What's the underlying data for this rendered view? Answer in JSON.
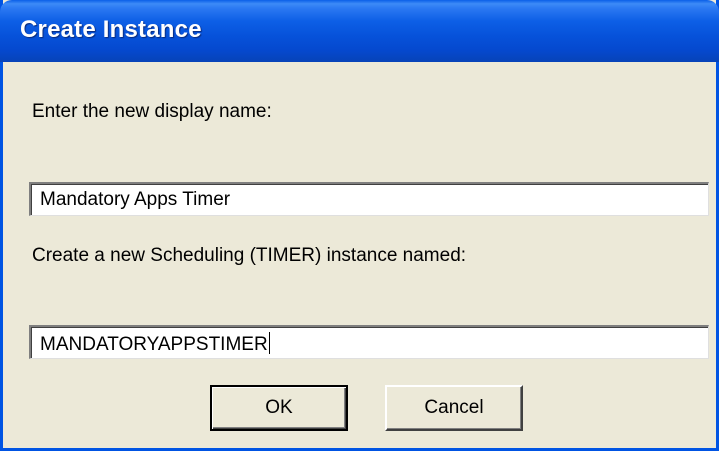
{
  "window": {
    "title": "Create Instance"
  },
  "form": {
    "display_name_label": "Enter the new display name:",
    "display_name_value": "Mandatory Apps Timer",
    "instance_label": "Create a new Scheduling (TIMER) instance named:",
    "instance_value": "MANDATORYAPPSTIMER"
  },
  "buttons": {
    "ok_label": "OK",
    "cancel_label": "Cancel"
  },
  "colors": {
    "title_bar": "#0054e3",
    "dialog_background": "#ece9d8"
  }
}
